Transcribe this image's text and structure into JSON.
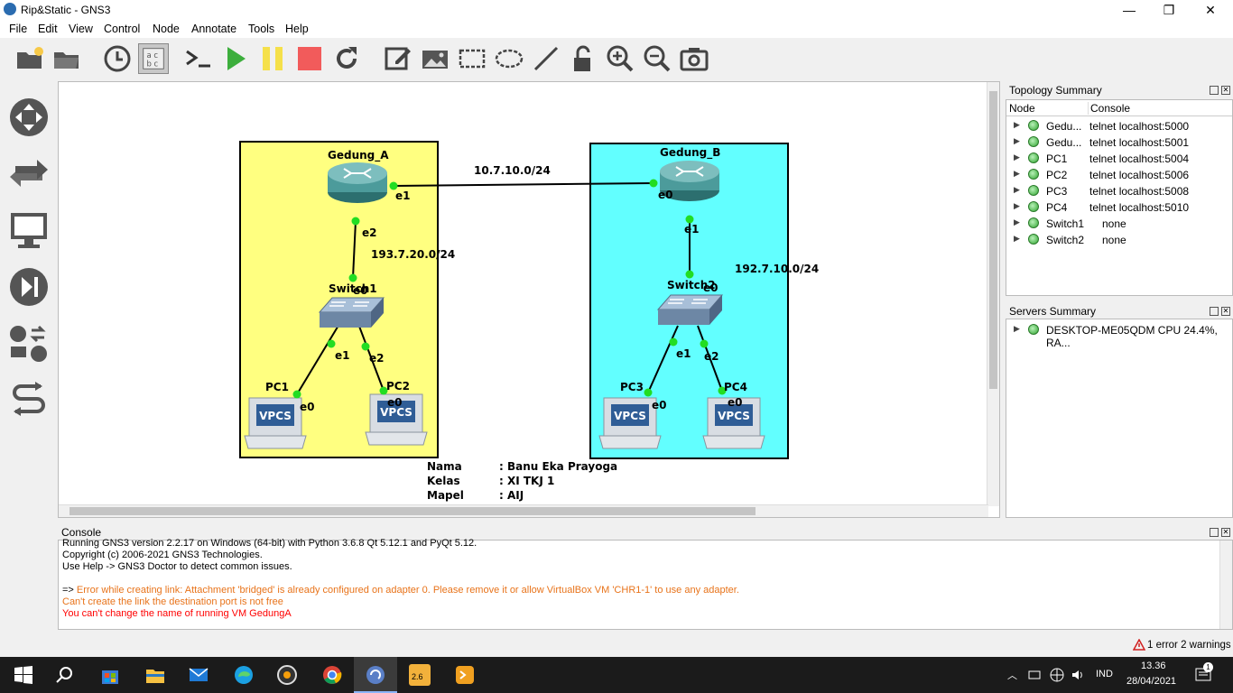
{
  "window": {
    "title": "Rip&Static - GNS3",
    "minimize": "—",
    "maximize": "❐",
    "close": "✕"
  },
  "menu": [
    "File",
    "Edit",
    "View",
    "Control",
    "Node",
    "Annotate",
    "Tools",
    "Help"
  ],
  "toolbar": [
    "open-project-icon",
    "folder-icon",
    "clock-icon",
    "show-interface-labels-icon",
    "console-icon",
    "start-icon",
    "pause-icon",
    "stop-icon",
    "reload-icon",
    "add-note-icon",
    "insert-picture-icon",
    "draw-rectangle-icon",
    "draw-ellipse-icon",
    "draw-line-icon",
    "lock-icon",
    "zoom-in-icon",
    "zoom-out-icon",
    "screenshot-icon"
  ],
  "leftbar": [
    "routers-icon",
    "switches-icon",
    "end-devices-icon",
    "security-devices-icon",
    "all-devices-icon",
    "add-link-icon"
  ],
  "topology": {
    "gedung_a": "Gedung_A",
    "gedung_b": "Gedung_B",
    "switch1": "Switch1",
    "switch2": "Switch2",
    "pc1": "PC1",
    "pc2": "PC2",
    "pc3": "PC3",
    "pc4": "PC4",
    "vpcs": "VPCS",
    "net_ab": "10.7.10.0/24",
    "net_a": "193.7.20.0/24",
    "net_b": "192.7.10.0/24",
    "if": {
      "e0": "e0",
      "e1": "e1",
      "e2": "e2"
    },
    "colors": {
      "zone_a": "#ffff80",
      "zone_b": "#62ffff",
      "link": "#000000",
      "port": "#22dd22"
    }
  },
  "note": {
    "labels": [
      "Nama",
      "Kelas",
      "Mapel"
    ],
    "values": [
      ": Banu Eka Prayoga",
      ": XI TKJ 1",
      ": AIJ"
    ]
  },
  "topology_summary": {
    "title": "Topology Summary",
    "col_node": "Node",
    "col_console": "Console",
    "rows": [
      {
        "node": "Gedu...",
        "console": "telnet localhost:5000"
      },
      {
        "node": "Gedu...",
        "console": "telnet localhost:5001"
      },
      {
        "node": "PC1",
        "console": "telnet localhost:5004"
      },
      {
        "node": "PC2",
        "console": "telnet localhost:5006"
      },
      {
        "node": "PC3",
        "console": "telnet localhost:5008"
      },
      {
        "node": "PC4",
        "console": "telnet localhost:5010"
      },
      {
        "node": "Switch1",
        "console": "none"
      },
      {
        "node": "Switch2",
        "console": "none"
      }
    ]
  },
  "servers_summary": {
    "title": "Servers Summary",
    "rows": [
      "DESKTOP-ME05QDM CPU 24.4%, RA..."
    ]
  },
  "console": {
    "title": "Console",
    "lines": [
      "Running GNS3 version 2.2.17 on Windows (64-bit) with Python 3.6.8 Qt 5.12.1 and PyQt 5.12.",
      "Copyright (c) 2006-2021 GNS3 Technologies.",
      "Use Help -> GNS3 Doctor to detect common issues."
    ],
    "prompt": "=>",
    "errors": [
      "Error while creating link: Attachment 'bridged' is already configured on adapter 0. Please remove it or allow VirtualBox VM 'CHR1-1' to use any adapter.",
      "Can't create the link the destination port is not free"
    ],
    "error_red": "You can't change the name of running VM GedungA",
    "colors": {
      "warn": "#e8731a",
      "error": "#ff0000"
    }
  },
  "status": {
    "summary": "1 error 2 warnings"
  },
  "taskbar": {
    "time": "13.36",
    "date": "28/04/2021",
    "lang": "IND",
    "notifications": "1",
    "badge": "2.6"
  }
}
